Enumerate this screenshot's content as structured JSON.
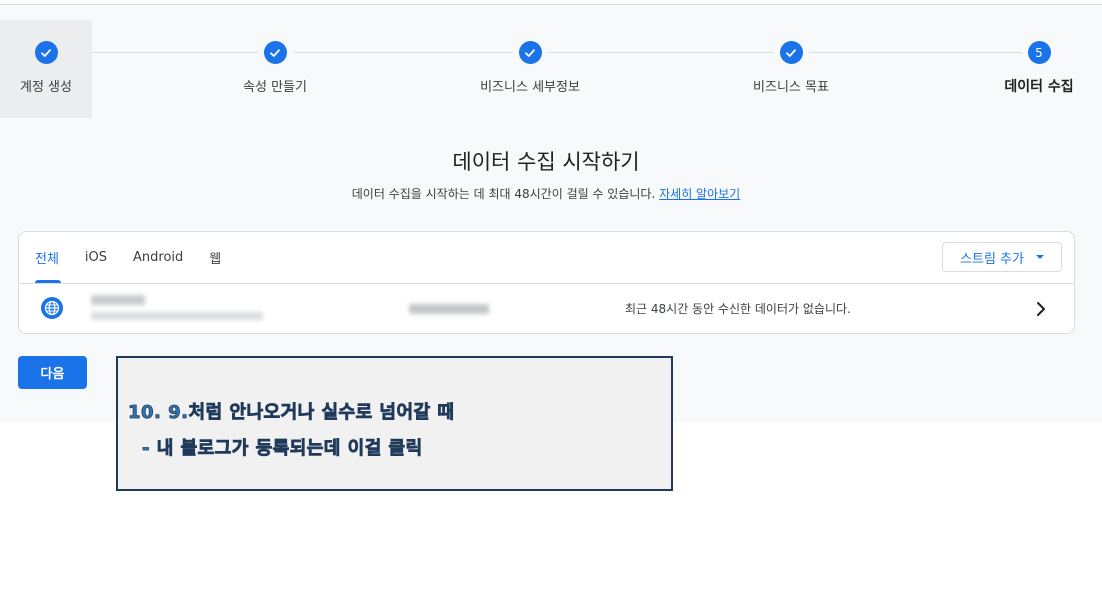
{
  "stepper": {
    "steps": [
      {
        "label": "계정 생성",
        "state": "done"
      },
      {
        "label": "속성 만들기",
        "state": "done"
      },
      {
        "label": "비즈니스 세부정보",
        "state": "done"
      },
      {
        "label": "비즈니스 목표",
        "state": "done"
      },
      {
        "label": "데이터 수집",
        "state": "current",
        "number": "5"
      }
    ]
  },
  "heading": {
    "title": "데이터 수집 시작하기",
    "subtitle": "데이터 수집을 시작하는 데 최대 48시간이 걸릴 수 있습니다.",
    "learn_more": "자세히 알아보기"
  },
  "card": {
    "tabs": [
      {
        "label": "전체",
        "selected": true
      },
      {
        "label": "iOS",
        "selected": false
      },
      {
        "label": "Android",
        "selected": false
      },
      {
        "label": "웹",
        "selected": false
      }
    ],
    "add_stream_label": "스트림 추가",
    "stream": {
      "icon": "globe-icon",
      "status": "최근 48시간 동안 수신한 데이터가 없습니다."
    }
  },
  "next_label": "다음",
  "annotation": {
    "line1": "10. 9.처럼 안나오거나 실수로 넘어갈 때",
    "line2": "- 내 블로그가 등록되는데 이걸 클릭"
  },
  "colors": {
    "accent": "#1a73e8",
    "annotation_text": "#2e75b6"
  }
}
